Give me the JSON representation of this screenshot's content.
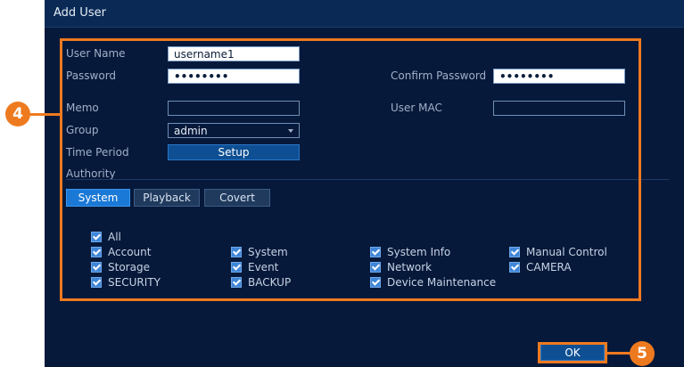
{
  "dialog": {
    "title": "Add User"
  },
  "form": {
    "user_name_label": "User Name",
    "user_name_value": "username1",
    "password_label": "Password",
    "password_value": "••••••••",
    "confirm_password_label": "Confirm Password",
    "confirm_password_value": "••••••••",
    "memo_label": "Memo",
    "memo_value": "",
    "user_mac_label": "User MAC",
    "user_mac_value": "",
    "group_label": "Group",
    "group_value": "admin",
    "time_period_label": "Time Period",
    "setup_label": "Setup"
  },
  "authority": {
    "label": "Authority",
    "tabs": [
      {
        "label": "System",
        "active": true
      },
      {
        "label": "Playback",
        "active": false
      },
      {
        "label": "Covert",
        "active": false
      }
    ],
    "permissions": [
      {
        "label": "All",
        "checked": true
      },
      {
        "label": "Account",
        "checked": true
      },
      {
        "label": "System",
        "checked": true
      },
      {
        "label": "System Info",
        "checked": true
      },
      {
        "label": "Manual Control",
        "checked": true
      },
      {
        "label": "Storage",
        "checked": true
      },
      {
        "label": "Event",
        "checked": true
      },
      {
        "label": "Network",
        "checked": true
      },
      {
        "label": "CAMERA",
        "checked": true
      },
      {
        "label": "SECURITY",
        "checked": true
      },
      {
        "label": "BACKUP",
        "checked": true
      },
      {
        "label": "Device Maintenance",
        "checked": true
      }
    ]
  },
  "footer": {
    "ok_label": "OK"
  },
  "annotations": {
    "step_a": "4",
    "step_b": "5",
    "accent_color": "#ee7a1f"
  }
}
